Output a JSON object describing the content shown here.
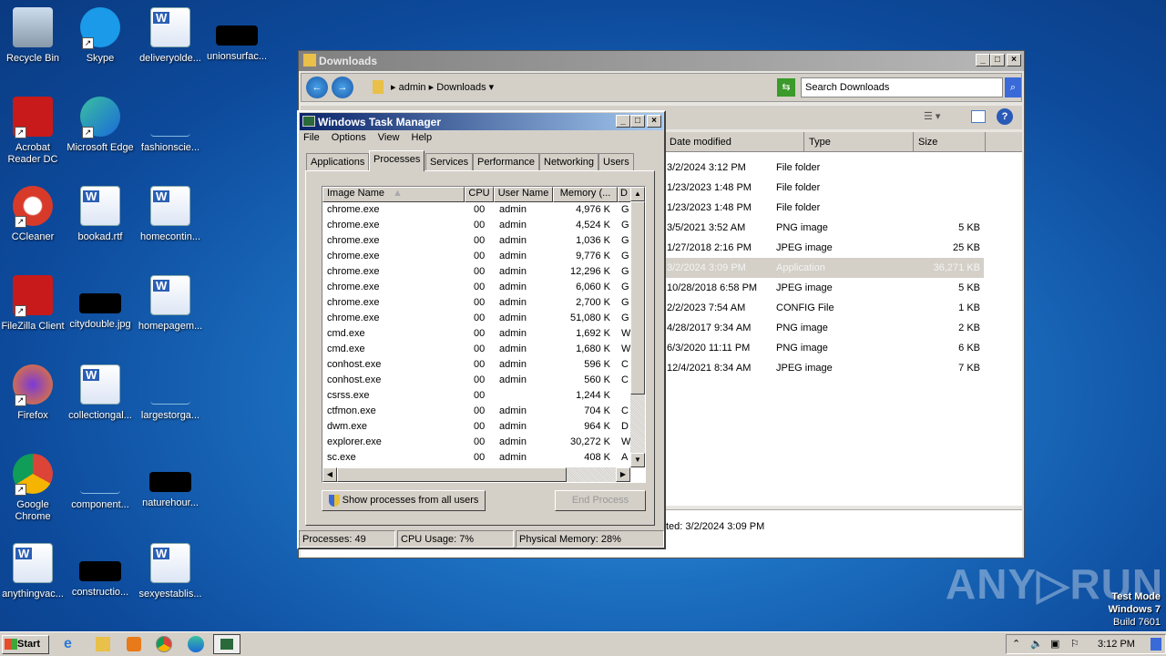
{
  "desktop_icons": [
    {
      "label": "Recycle Bin",
      "type": "recycle"
    },
    {
      "label": "Skype",
      "type": "skype"
    },
    {
      "label": "deliveryolde...",
      "type": "doc"
    },
    {
      "label": "unionsurfac...",
      "type": "black"
    },
    {
      "label": "Acrobat Reader DC",
      "type": "acrobat"
    },
    {
      "label": "Microsoft Edge",
      "type": "edge"
    },
    {
      "label": "fashionscie...",
      "type": "blank"
    },
    {
      "label": "CCleaner",
      "type": "ccleaner"
    },
    {
      "label": "bookad.rtf",
      "type": "doc"
    },
    {
      "label": "homecontin...",
      "type": "doc"
    },
    {
      "label": "FileZilla Client",
      "type": "filezilla"
    },
    {
      "label": "citydouble.jpg",
      "type": "black"
    },
    {
      "label": "homepagem...",
      "type": "doc"
    },
    {
      "label": "Firefox",
      "type": "firefox"
    },
    {
      "label": "collectiongal...",
      "type": "doc"
    },
    {
      "label": "largestorga...",
      "type": "blank"
    },
    {
      "label": "Google Chrome",
      "type": "chrome"
    },
    {
      "label": "component...",
      "type": "blank"
    },
    {
      "label": "naturehour...",
      "type": "black"
    },
    {
      "label": "anythingvac...",
      "type": "doc"
    },
    {
      "label": "constructio...",
      "type": "black"
    },
    {
      "label": "sexyestablis...",
      "type": "doc"
    }
  ],
  "explorer": {
    "title": "Downloads",
    "breadcrumb": [
      "admin",
      "Downloads"
    ],
    "search_placeholder": "Search Downloads",
    "columns": [
      "Date modified",
      "Type",
      "Size"
    ],
    "rows": [
      {
        "date": "3/2/2024 3:12 PM",
        "type": "File folder",
        "size": ""
      },
      {
        "date": "1/23/2023 1:48 PM",
        "type": "File folder",
        "size": ""
      },
      {
        "date": "1/23/2023 1:48 PM",
        "type": "File folder",
        "size": ""
      },
      {
        "date": "3/5/2021 3:52 AM",
        "type": "PNG image",
        "size": "5 KB"
      },
      {
        "date": "1/27/2018 2:16 PM",
        "type": "JPEG image",
        "size": "25 KB"
      },
      {
        "date": "3/2/2024 3:09 PM",
        "type": "Application",
        "size": "36,271 KB",
        "selected": true
      },
      {
        "date": "10/28/2018 6:58 PM",
        "type": "JPEG image",
        "size": "5 KB"
      },
      {
        "date": "2/2/2023 7:54 AM",
        "type": "CONFIG File",
        "size": "1 KB"
      },
      {
        "date": "4/28/2017 9:34 AM",
        "type": "PNG image",
        "size": "2 KB"
      },
      {
        "date": "6/3/2020 11:11 PM",
        "type": "PNG image",
        "size": "6 KB"
      },
      {
        "date": "12/4/2021 8:34 AM",
        "type": "JPEG image",
        "size": "7 KB"
      }
    ],
    "details_text": "ted: 3/2/2024 3:09 PM"
  },
  "taskmgr": {
    "title": "Windows Task Manager",
    "menu": [
      "File",
      "Options",
      "View",
      "Help"
    ],
    "tabs": [
      "Applications",
      "Processes",
      "Services",
      "Performance",
      "Networking",
      "Users"
    ],
    "active_tab": "Processes",
    "columns": [
      "Image Name",
      "CPU",
      "User Name",
      "Memory (...",
      "D"
    ],
    "processes": [
      [
        "chrome.exe",
        "00",
        "admin",
        "4,976 K",
        "G"
      ],
      [
        "chrome.exe",
        "00",
        "admin",
        "4,524 K",
        "G"
      ],
      [
        "chrome.exe",
        "00",
        "admin",
        "1,036 K",
        "G"
      ],
      [
        "chrome.exe",
        "00",
        "admin",
        "9,776 K",
        "G"
      ],
      [
        "chrome.exe",
        "00",
        "admin",
        "12,296 K",
        "G"
      ],
      [
        "chrome.exe",
        "00",
        "admin",
        "6,060 K",
        "G"
      ],
      [
        "chrome.exe",
        "00",
        "admin",
        "2,700 K",
        "G"
      ],
      [
        "chrome.exe",
        "00",
        "admin",
        "51,080 K",
        "G"
      ],
      [
        "cmd.exe",
        "00",
        "admin",
        "1,692 K",
        "W"
      ],
      [
        "cmd.exe",
        "00",
        "admin",
        "1,680 K",
        "W"
      ],
      [
        "conhost.exe",
        "00",
        "admin",
        "596 K",
        "C"
      ],
      [
        "conhost.exe",
        "00",
        "admin",
        "560 K",
        "C"
      ],
      [
        "csrss.exe",
        "00",
        "",
        "1,244 K",
        ""
      ],
      [
        "ctfmon.exe",
        "00",
        "admin",
        "704 K",
        "C"
      ],
      [
        "dwm.exe",
        "00",
        "admin",
        "964 K",
        "D"
      ],
      [
        "explorer.exe",
        "00",
        "admin",
        "30,272 K",
        "W"
      ],
      [
        "sc.exe",
        "00",
        "admin",
        "408 K",
        "A"
      ]
    ],
    "show_all_label": "Show processes from all users",
    "end_process_label": "End Process",
    "status": {
      "processes": "Processes: 49",
      "cpu": "CPU Usage: 7%",
      "memory": "Physical Memory: 28%"
    }
  },
  "taskbar": {
    "start_label": "Start",
    "clock": "3:12 PM"
  },
  "watermark": {
    "brand": "ANY RUN",
    "lines": [
      "Test Mode",
      "Windows 7",
      "Build 7601"
    ]
  }
}
